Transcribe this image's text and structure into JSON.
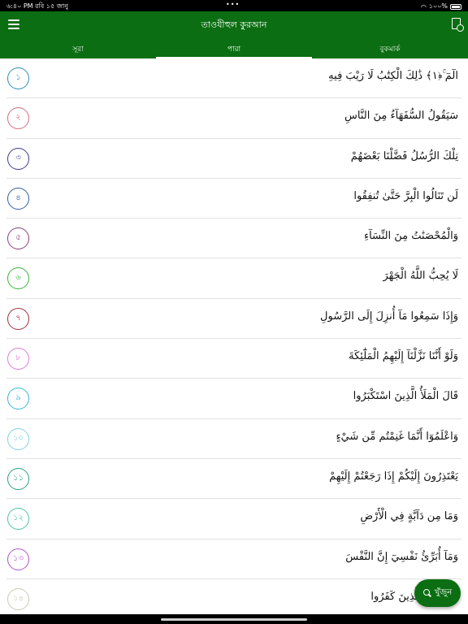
{
  "status_bar": {
    "time": "৬:৪০ PM",
    "date": "রবি ১৫ জানু",
    "dots": "•••",
    "battery": "১০০%"
  },
  "app_bar": {
    "title": "তাওযীহুল কুরআন",
    "menu_icon": "menu-icon",
    "right_icon": "document-search-icon"
  },
  "tabs": [
    {
      "label": "সূরা",
      "active": false
    },
    {
      "label": "পারা",
      "active": true
    },
    {
      "label": "বুকমার্ক",
      "active": false
    }
  ],
  "paras": [
    {
      "number": "১",
      "arabic": "الٓمٓ ۚ﴿١﴾ ذَٰلِكَ الْكِتَٰبُ لَا رَيْبَ فِيهِ",
      "color": "#2f8fb5"
    },
    {
      "number": "২",
      "arabic": "سَيَقُولُ السُّفَهَآءُ مِنَ النَّاسِ",
      "color": "#d06e7f"
    },
    {
      "number": "৩",
      "arabic": "تِلْكَ الرُّسُلُ فَضَّلْنَا بَعْضَهُمْ",
      "color": "#3d3a8f"
    },
    {
      "number": "৪",
      "arabic": "لَن تَنَالُوا الْبِرَّ حَتَّىٰ تُنفِقُوا",
      "color": "#2e5ea8"
    },
    {
      "number": "৫",
      "arabic": "وَالْمُحْصَنَٰتُ مِنَ النِّسَآءِ",
      "color": "#8b3f7a"
    },
    {
      "number": "৬",
      "arabic": "لَا يُحِبُّ اللَّهُ الْجَهْرَ",
      "color": "#39b53a"
    },
    {
      "number": "৭",
      "arabic": "وَإِذَا سَمِعُوا مَآ أُنزِلَ إِلَى الرَّسُولِ",
      "color": "#a0303f"
    },
    {
      "number": "৮",
      "arabic": "وَلَوْ أَنَّنَا نَزَّلْنَآ إِلَيْهِمُ الْمَلَٰٓئِكَةَ",
      "color": "#e07ad6"
    },
    {
      "number": "৯",
      "arabic": "قَالَ الْمَلَأُ الَّذِينَ اسْتَكْبَرُوا",
      "color": "#38b8d8"
    },
    {
      "number": "১০",
      "arabic": "وَاعْلَمُوٓا أَنَّمَا غَنِمْتُم مِّن شَيْءٍ",
      "color": "#7fd1e0"
    },
    {
      "number": "১১",
      "arabic": "يَعْتَذِرُونَ إِلَيْكُمْ إِذَا رَجَعْتُمْ إِلَيْهِمْ",
      "color": "#2aa187"
    },
    {
      "number": "১২",
      "arabic": "وَمَا مِن دَآبَّةٍ فِي الْأَرْضِ",
      "color": "#4cc2a6"
    },
    {
      "number": "১৩",
      "arabic": "وَمَآ أُبَرِّئُ نَفْسِيٓ إِنَّ النَّفْسَ",
      "color": "#b455c9"
    },
    {
      "number": "১৪",
      "arabic": "رُبَمَا يَوَدُّ الَّذِينَ كَفَرُوا",
      "color": "#c9c9b8"
    }
  ],
  "fab": {
    "label": "খুঁজুন",
    "icon": "search-icon"
  }
}
